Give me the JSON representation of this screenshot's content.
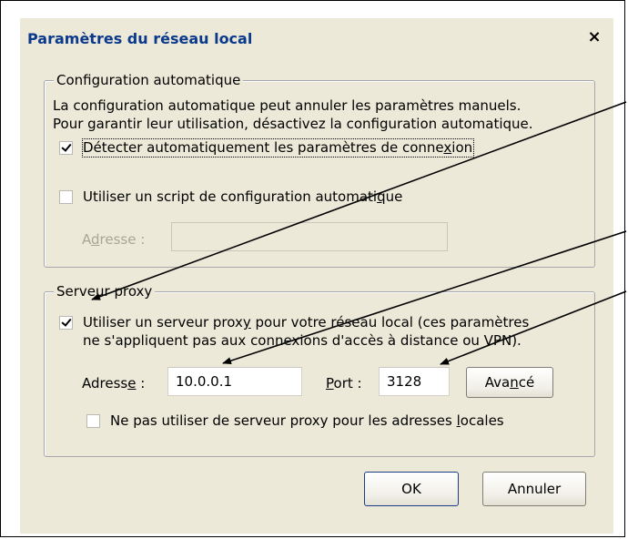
{
  "dialog": {
    "title": "Paramètres du réseau local",
    "close_glyph": "×"
  },
  "auto_config": {
    "legend": "Configuration automatique",
    "description_line1": "La configuration automatique peut annuler les paramètres manuels.",
    "description_line2": "Pour garantir leur utilisation, désactivez la configuration automatique.",
    "detect_label_pre": "Détecter automatiquement les paramètres de conne",
    "detect_label_u": "x",
    "detect_label_post": "ion",
    "detect_checked": true,
    "script_label_pre": "Utiliser un script de configuration automati",
    "script_label_u": "q",
    "script_label_post": "ue",
    "script_checked": false,
    "address_label_pre": "A",
    "address_label_u": "d",
    "address_label_post": "resse :",
    "address_value": ""
  },
  "proxy": {
    "legend": "Serveur proxy",
    "use_proxy_line1_pre": "Utiliser un serveur prox",
    "use_proxy_line1_u": "y",
    "use_proxy_line1_post": " pour votre réseau local (ces paramètres",
    "use_proxy_line2": "ne s'appliquent pas aux connexions d'accès à distance ou VPN).",
    "use_proxy_checked": true,
    "address_label_pre": "Adress",
    "address_label_u": "e",
    "address_label_post": " :",
    "address_value": "10.0.0.1",
    "port_label_u": "P",
    "port_label_post": "ort :",
    "port_value": "3128",
    "advanced_pre": "Ava",
    "advanced_u": "n",
    "advanced_post": "cé",
    "bypass_label_pre": "Ne pas utiliser de serveur proxy pour les adresses ",
    "bypass_label_u": "l",
    "bypass_label_post": "ocales",
    "bypass_checked": false
  },
  "buttons": {
    "ok": "OK",
    "cancel": "Annuler"
  },
  "colors": {
    "dialog_bg": "#ece9d8",
    "title_text": "#0b3a8c",
    "disabled_text": "#a8a699"
  }
}
